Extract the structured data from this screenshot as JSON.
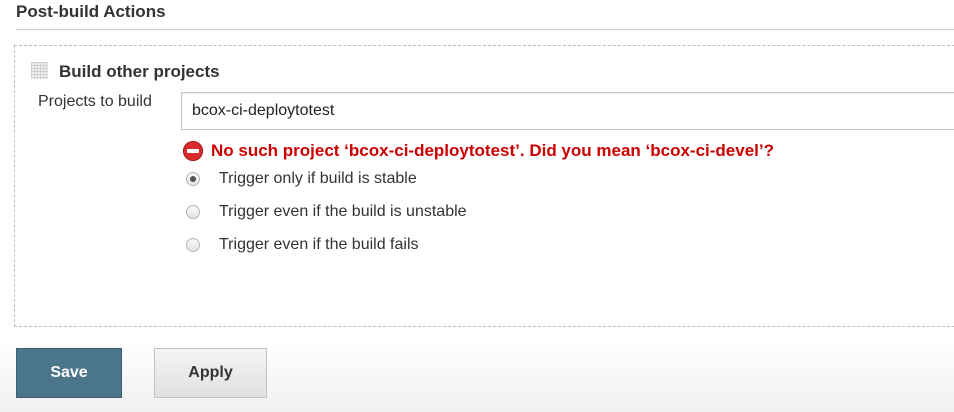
{
  "section": {
    "title": "Post-build Actions"
  },
  "block": {
    "title": "Build other projects",
    "projects_label": "Projects to build",
    "projects_value": "bcox-ci-deploytotest",
    "error": "No such project ‘bcox-ci-deploytotest’. Did you mean ‘bcox-ci-devel’?"
  },
  "options": [
    {
      "label": "Trigger only if build is stable",
      "checked": true
    },
    {
      "label": "Trigger even if the build is unstable",
      "checked": false
    },
    {
      "label": "Trigger even if the build fails",
      "checked": false
    }
  ],
  "buttons": {
    "save": "Save",
    "apply": "Apply"
  },
  "colors": {
    "error": "#cc0000",
    "save_bg": "#4b758b"
  },
  "icons": {
    "error": "error-circle-icon",
    "drag": "drag-handle-icon"
  }
}
